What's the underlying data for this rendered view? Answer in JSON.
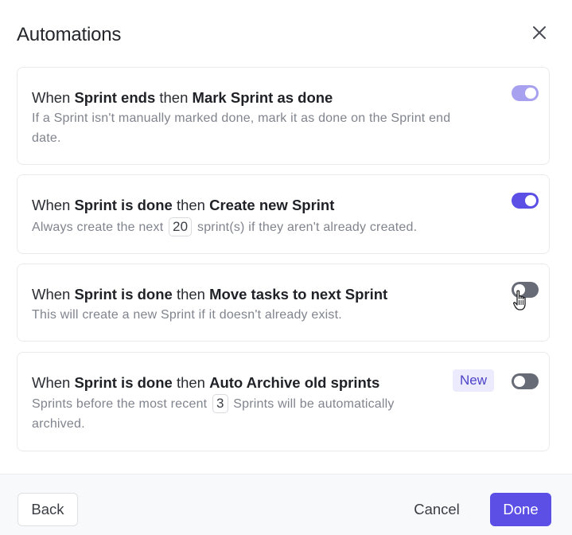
{
  "dialog": {
    "title": "Automations",
    "close_icon": "close-icon"
  },
  "automations": [
    {
      "when": "When",
      "trigger": "Sprint ends",
      "then": "then",
      "action": "Mark Sprint as done",
      "description_line1": "If a Sprint isn't manually marked done, mark it as done on the Sprint end",
      "description_line2": "date.",
      "enabled": true,
      "state": "on-disabled"
    },
    {
      "when": "When",
      "trigger": "Sprint is done",
      "then": "then",
      "action": "Create new Sprint",
      "description_before": "Always create the next",
      "count": "20",
      "description_after": "sprint(s) if they aren't already created.",
      "enabled": true,
      "state": "on"
    },
    {
      "when": "When",
      "trigger": "Sprint is done",
      "then": "then",
      "action": "Move tasks to next Sprint",
      "description": "This will create a new Sprint if it doesn't already exist.",
      "enabled": false,
      "state": "off"
    },
    {
      "when": "When",
      "trigger": "Sprint is done",
      "then": "then",
      "action": "Auto Archive old sprints",
      "badge": "New",
      "description_before": "Sprints before the most recent",
      "count": "3",
      "description_after": "Sprints will be automatically",
      "description_line2": "archived.",
      "enabled": false,
      "state": "off"
    }
  ],
  "footer": {
    "back_label": "Back",
    "cancel_label": "Cancel",
    "done_label": "Done"
  },
  "colors": {
    "accent": "#5b4fe6",
    "accent_light": "#a8a1f0",
    "toggle_off": "#666b75",
    "badge_bg": "#ecebfd",
    "badge_text": "#4c42c7"
  }
}
